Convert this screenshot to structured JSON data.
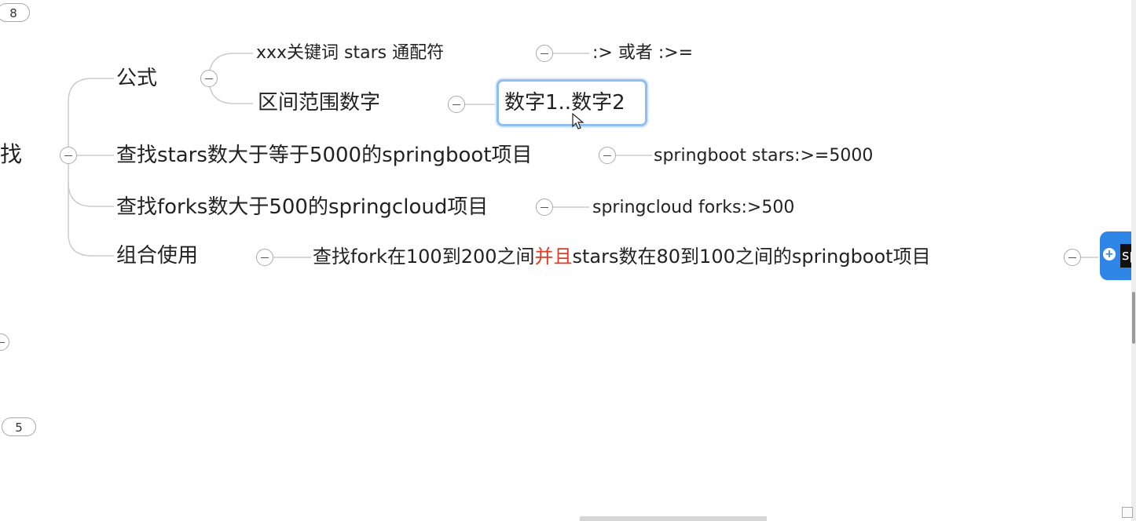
{
  "badges": {
    "top": "8",
    "bottom": "5"
  },
  "root": {
    "label": "找"
  },
  "formula": {
    "label": "公式",
    "syntax": {
      "label": "xxx关键词  stars  通配符",
      "result": ":>   或者 :>="
    },
    "range": {
      "label": "区间范围数字",
      "result": "数字1..数字2"
    }
  },
  "branches": {
    "stars_search": {
      "label": "查找stars数大于等于5000的springboot项目",
      "result": "springboot stars:>=5000"
    },
    "forks_search": {
      "label": "查找forks数大于500的springcloud项目",
      "result": "springcloud forks:>500"
    },
    "combined": {
      "label": "组合使用",
      "description_prefix": "查找fork在100到200之间",
      "description_highlight": "并且",
      "description_suffix": "stars数在80到100之间的springboot项目",
      "child_preview": "sp"
    }
  },
  "colors": {
    "line": "#c8c8c8",
    "highlight": "#e03b24",
    "selection": "#8fbfef",
    "accent": "#2f86e6"
  }
}
